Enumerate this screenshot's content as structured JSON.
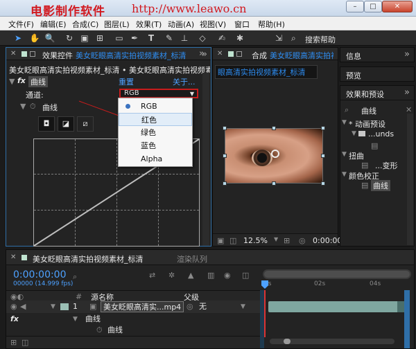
{
  "watermark": {
    "text_cn": "电影制作软件",
    "url": "http://www.leawo.cn"
  },
  "window_controls": {
    "minimize": "–",
    "maximize": "□",
    "close": "✕"
  },
  "menu": [
    "文件(F)",
    "编辑(E)",
    "合成(C)",
    "图层(L)",
    "效果(T)",
    "动画(A)",
    "视图(V)",
    "窗口",
    "帮助(H)"
  ],
  "toolbar": {
    "search_label": "搜索帮助"
  },
  "effects_controls": {
    "tab_label": "效果控件",
    "tab_source": "美女眨眼高清实拍视频素材_标清",
    "breadcrumb": "美女眨眼高清实拍视频素材_标清 • 美女眨眼高清实拍视频素",
    "fx_label": "fx",
    "effect_name": "曲线",
    "reset": "重置",
    "about": "关于...",
    "channel_label": "通道:",
    "channel_value": "RGB",
    "curves_label": "曲线",
    "channel_options": [
      "RGB",
      "红色",
      "绿色",
      "蓝色",
      "Alpha"
    ]
  },
  "composition": {
    "tab_label": "合成",
    "tab_source": "美女眨眼高清实拍视频素材_标清",
    "sub_tab": "眼高清实拍视频素材_标清",
    "zoom": "12.5%",
    "timecode": "0:00:00"
  },
  "side_panels": {
    "info": "信息",
    "preview": "预览",
    "effects_presets": "效果和预设",
    "search_value": "曲线",
    "tree": [
      {
        "label": "* 动画预设",
        "level": 0
      },
      {
        "label": "...unds",
        "level": 1
      },
      {
        "label": "...变形",
        "level": 2
      },
      {
        "label": "扭曲",
        "level": 0
      },
      {
        "label": "颜色校正",
        "level": 0
      },
      {
        "label": "曲线",
        "level": 2
      }
    ]
  },
  "timeline": {
    "tab_label": "美女眨眼高清实拍视频素材_标清",
    "render_queue": "渲染队列",
    "timecode": "0:00:00:00",
    "frames": "00000 (14.999 fps)",
    "col_source": "源名称",
    "col_parent": "父级",
    "layer_number": "1",
    "layer_name": "美女眨眼高清实...mp4",
    "parent_value": "无",
    "effect_row": "曲线",
    "property_row": "曲线",
    "ruler": [
      "0s",
      "02s",
      "04s"
    ]
  }
}
